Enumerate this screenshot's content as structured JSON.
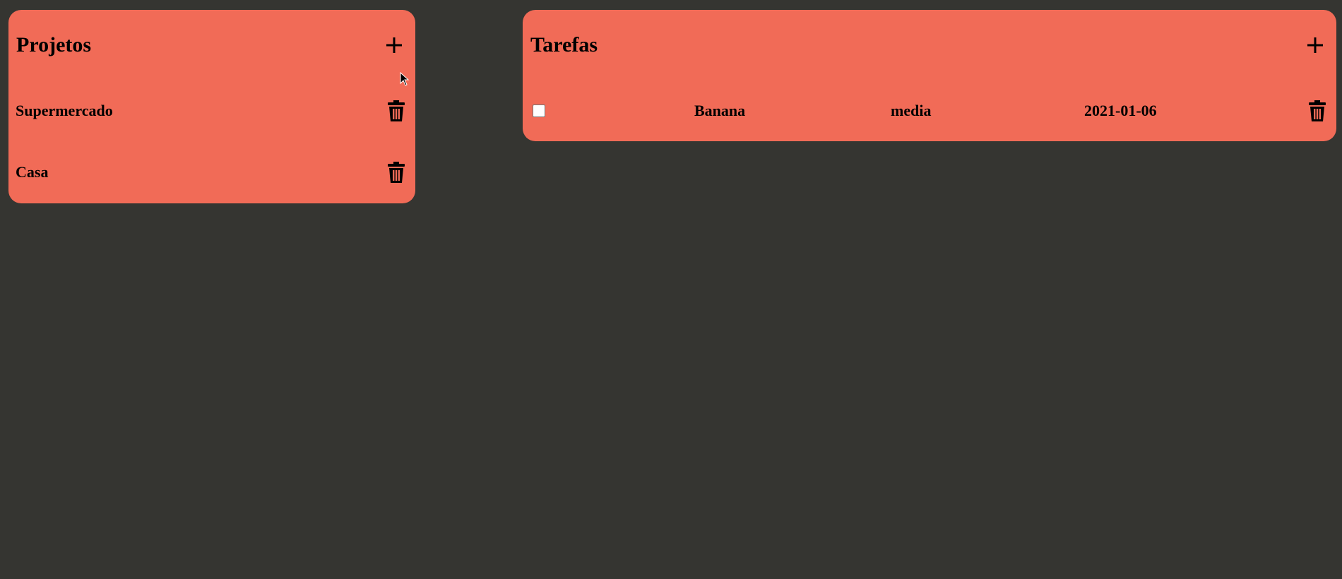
{
  "projects": {
    "title": "Projetos",
    "items": [
      {
        "label": "Supermercado"
      },
      {
        "label": "Casa"
      }
    ]
  },
  "tasks": {
    "title": "Tarefas",
    "items": [
      {
        "checked": false,
        "name": "Banana",
        "priority": "media",
        "date": "2021-01-06"
      }
    ]
  },
  "theme": {
    "background": "#353531",
    "panel": "#f16b57"
  },
  "icons": {
    "add": "plus-icon",
    "delete": "trash-icon"
  }
}
